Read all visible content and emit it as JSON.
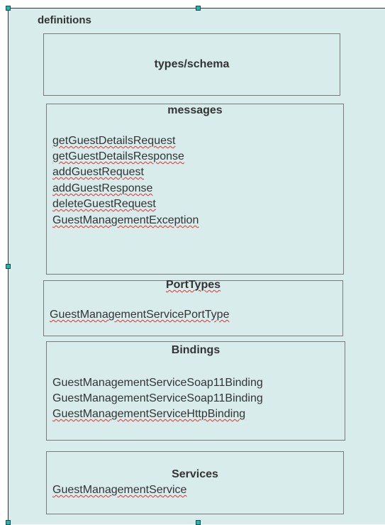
{
  "diagram": {
    "title": "definitions",
    "types": {
      "title": "types/schema"
    },
    "messages": {
      "title": "messages",
      "items": [
        "getGuestDetailsRequest",
        "getGuestDetailsResponse",
        "addGuestRequest",
        "addGuestResponse",
        "deleteGuestRequest",
        "GuestManagementException"
      ]
    },
    "port_types": {
      "title": "PortTypes",
      "items": [
        "GuestManagementServicePortType"
      ]
    },
    "bindings": {
      "title": "Bindings",
      "items": [
        "GuestManagementServiceSoap11Binding",
        "GuestManagementServiceSoap11Binding",
        "GuestManagementServiceHttpBinding"
      ]
    },
    "services": {
      "title": "Services",
      "items": [
        "GuestManagementService"
      ]
    }
  },
  "colors": {
    "background": "#d8ecec",
    "border": "#7a7a7a",
    "text": "#333333",
    "handle": "#21b3b8",
    "spell_underline": "#e03030"
  }
}
